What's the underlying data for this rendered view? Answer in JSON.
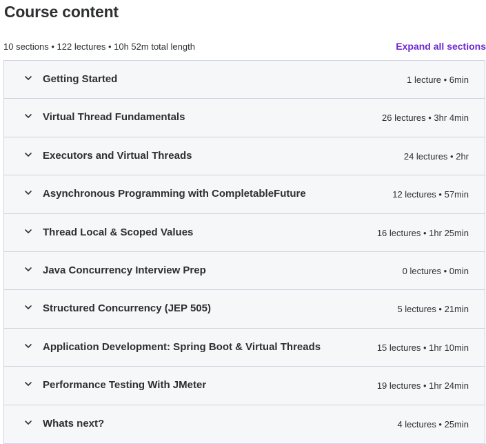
{
  "header": {
    "title": "Course content",
    "summary": "10 sections • 122 lectures • 10h 52m total length",
    "expand_all_label": "Expand all sections"
  },
  "sections": [
    {
      "title": "Getting Started",
      "meta": "1 lecture • 6min"
    },
    {
      "title": "Virtual Thread Fundamentals",
      "meta": "26 lectures • 3hr 4min"
    },
    {
      "title": "Executors and Virtual Threads",
      "meta": "24 lectures • 2hr"
    },
    {
      "title": "Asynchronous Programming with CompletableFuture",
      "meta": "12 lectures • 57min"
    },
    {
      "title": "Thread Local & Scoped Values",
      "meta": "16 lectures • 1hr 25min"
    },
    {
      "title": "Java Concurrency Interview Prep",
      "meta": "0 lectures • 0min"
    },
    {
      "title": "Structured Concurrency (JEP 505)",
      "meta": "5 lectures • 21min"
    },
    {
      "title": "Application Development: Spring Boot & Virtual Threads",
      "meta": "15 lectures • 1hr 10min"
    },
    {
      "title": "Performance Testing With JMeter",
      "meta": "19 lectures • 1hr 24min"
    },
    {
      "title": "Whats next?",
      "meta": "4 lectures • 25min"
    }
  ],
  "icons": {
    "section_toggle": "chevron-down-icon"
  },
  "colors": {
    "accent": "#6d28d2",
    "text": "#2d2f31",
    "section_bg": "#f6f7f9",
    "border": "#d1d2e0"
  }
}
